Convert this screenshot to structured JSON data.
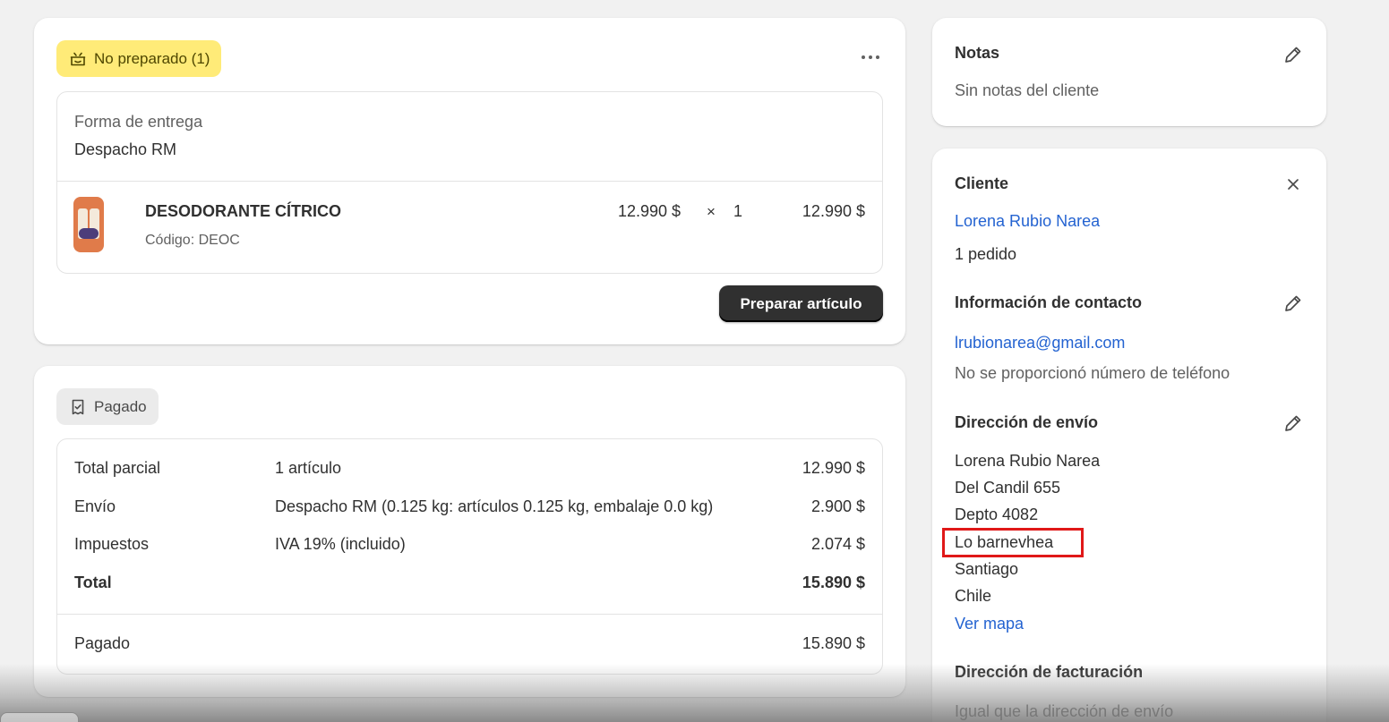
{
  "fulfillment": {
    "status_badge": "No preparado (1)",
    "delivery_label": "Forma de entrega",
    "delivery_method": "Despacho RM",
    "item": {
      "name": "DESODORANTE CÍTRICO",
      "sku": "Código: DEOC",
      "unit_price": "12.990 $",
      "times": "×",
      "quantity": "1",
      "total": "12.990 $"
    },
    "prepare_button": "Preparar artículo"
  },
  "payment": {
    "status_badge": "Pagado",
    "rows": [
      {
        "label": "Total parcial",
        "detail": "1 artículo",
        "amount": "12.990 $"
      },
      {
        "label": "Envío",
        "detail": "Despacho RM (0.125 kg: artículos 0.125 kg, embalaje 0.0 kg)",
        "amount": "2.900 $"
      },
      {
        "label": "Impuestos",
        "detail": "IVA 19% (incluido)",
        "amount": "2.074 $"
      },
      {
        "label": "Total",
        "detail": "",
        "amount": "15.890 $"
      }
    ],
    "paid_label": "Pagado",
    "paid_amount": "15.890 $"
  },
  "notes": {
    "title": "Notas",
    "text": "Sin notas del cliente"
  },
  "customer": {
    "title": "Cliente",
    "name": "Lorena Rubio Narea",
    "orders": "1 pedido",
    "contact_title": "Información de contacto",
    "email": "lrubionarea@gmail.com",
    "phone": "No se proporcionó número de teléfono",
    "shipping_title": "Dirección de envío",
    "shipping_lines": [
      "Lorena Rubio Narea",
      "Del Candil 655",
      "Depto 4082",
      "Lo barnevhea",
      "Santiago",
      "Chile"
    ],
    "map_link": "Ver mapa",
    "billing_title": "Dirección de facturación",
    "billing_text": "Igual que la dirección de envío"
  },
  "colors": {
    "unfulfilled_badge": "#ffeb78",
    "paid_badge": "#ebebeb",
    "link": "#2463d1",
    "primary_button": "#303030",
    "highlight": "#e01818"
  }
}
